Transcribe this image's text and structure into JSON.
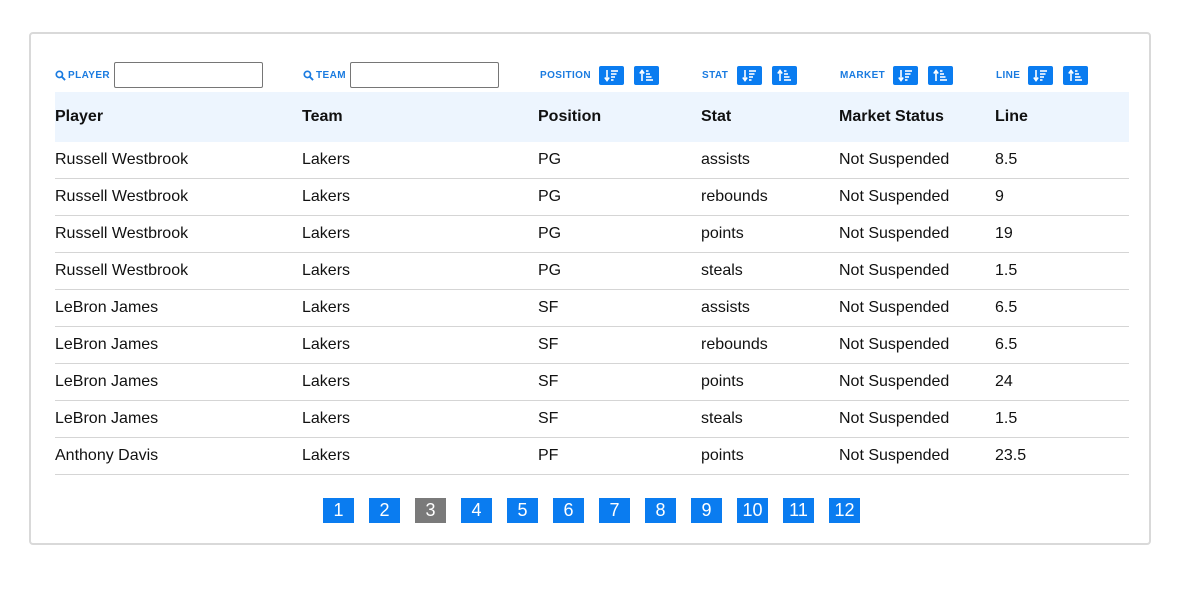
{
  "filters": {
    "player_label": "PLAYER",
    "team_label": "TEAM",
    "position_label": "POSITION",
    "stat_label": "STAT",
    "market_label": "MARKET",
    "line_label": "LINE",
    "player_value": "",
    "team_value": ""
  },
  "columns": [
    "Player",
    "Team",
    "Position",
    "Stat",
    "Market Status",
    "Line"
  ],
  "rows": [
    [
      "Russell Westbrook",
      "Lakers",
      "PG",
      "assists",
      "Not Suspended",
      "8.5"
    ],
    [
      "Russell Westbrook",
      "Lakers",
      "PG",
      "rebounds",
      "Not Suspended",
      "9"
    ],
    [
      "Russell Westbrook",
      "Lakers",
      "PG",
      "points",
      "Not Suspended",
      "19"
    ],
    [
      "Russell Westbrook",
      "Lakers",
      "PG",
      "steals",
      "Not Suspended",
      "1.5"
    ],
    [
      "LeBron James",
      "Lakers",
      "SF",
      "assists",
      "Not Suspended",
      "6.5"
    ],
    [
      "LeBron James",
      "Lakers",
      "SF",
      "rebounds",
      "Not Suspended",
      "6.5"
    ],
    [
      "LeBron James",
      "Lakers",
      "SF",
      "points",
      "Not Suspended",
      "24"
    ],
    [
      "LeBron James",
      "Lakers",
      "SF",
      "steals",
      "Not Suspended",
      "1.5"
    ],
    [
      "Anthony Davis",
      "Lakers",
      "PF",
      "points",
      "Not Suspended",
      "23.5"
    ]
  ],
  "pagination": {
    "pages": [
      "1",
      "2",
      "3",
      "4",
      "5",
      "6",
      "7",
      "8",
      "9",
      "10",
      "11",
      "12"
    ],
    "active": "3"
  },
  "colors": {
    "accent": "#0a7cf0",
    "label": "#1a7be0",
    "header_bg": "#edf5fe",
    "active_page": "#7a7a7a"
  }
}
